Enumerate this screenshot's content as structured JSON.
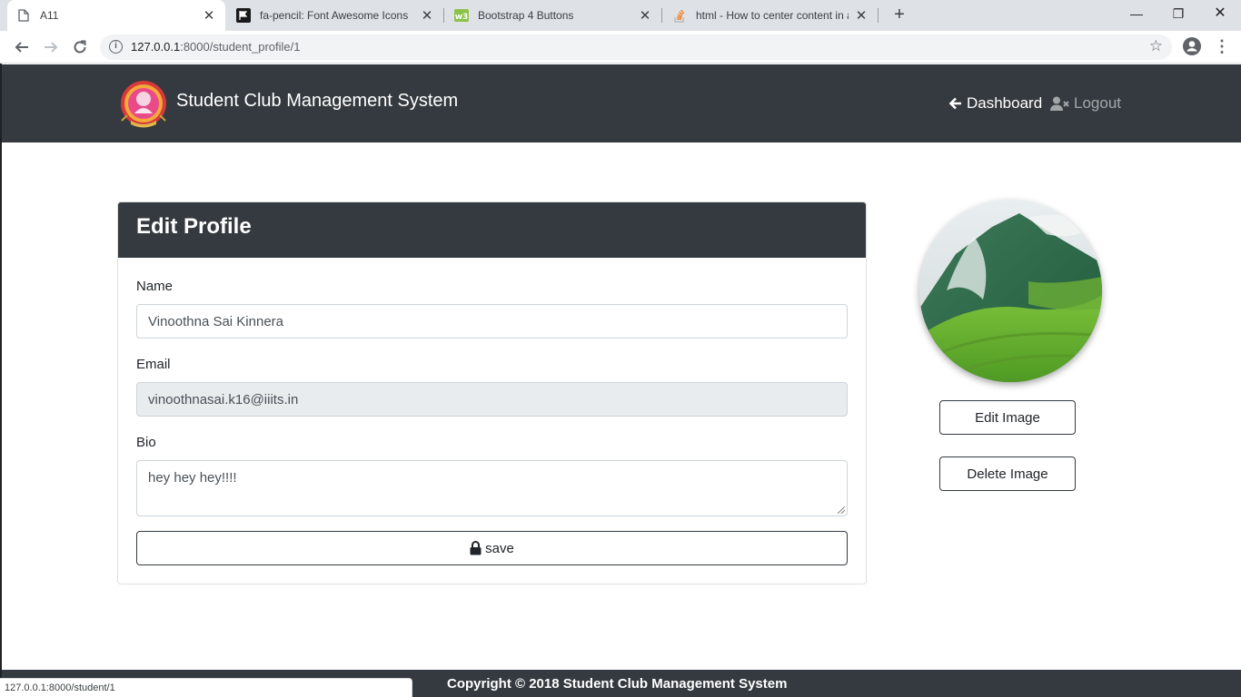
{
  "browser": {
    "tabs": [
      {
        "title": "A11",
        "icon": "page-icon"
      },
      {
        "title": "fa-pencil: Font Awesome Icons",
        "icon": "flag-icon"
      },
      {
        "title": "Bootstrap 4 Buttons",
        "icon": "w3schools-icon"
      },
      {
        "title": "html - How to center content in a",
        "icon": "stackoverflow-icon"
      }
    ],
    "url_host": "127.0.0.1",
    "url_path": ":8000/student_profile/1",
    "status_url": "127.0.0.1:8000/student/1"
  },
  "navbar": {
    "brand": "Student Club Management System",
    "links": [
      {
        "label": "Dashboard",
        "icon": "arrow-left-icon"
      },
      {
        "label": "Logout",
        "icon": "user-times-icon"
      }
    ]
  },
  "form": {
    "title": "Edit Profile",
    "name_label": "Name",
    "name_value": "Vinoothna Sai Kinnera",
    "email_label": "Email",
    "email_value": "vinoothnasai.k16@iiits.in",
    "bio_label": "Bio",
    "bio_value": "hey hey hey!!!!",
    "save_label": "save",
    "save_icon": "lock-icon"
  },
  "profile": {
    "edit_image_label": "Edit Image",
    "delete_image_label": "Delete Image"
  },
  "footer": {
    "text": "Copyright © 2018 Student Club Management System"
  },
  "colors": {
    "dark": "#343a40",
    "tabstrip": "#dee1e6"
  }
}
